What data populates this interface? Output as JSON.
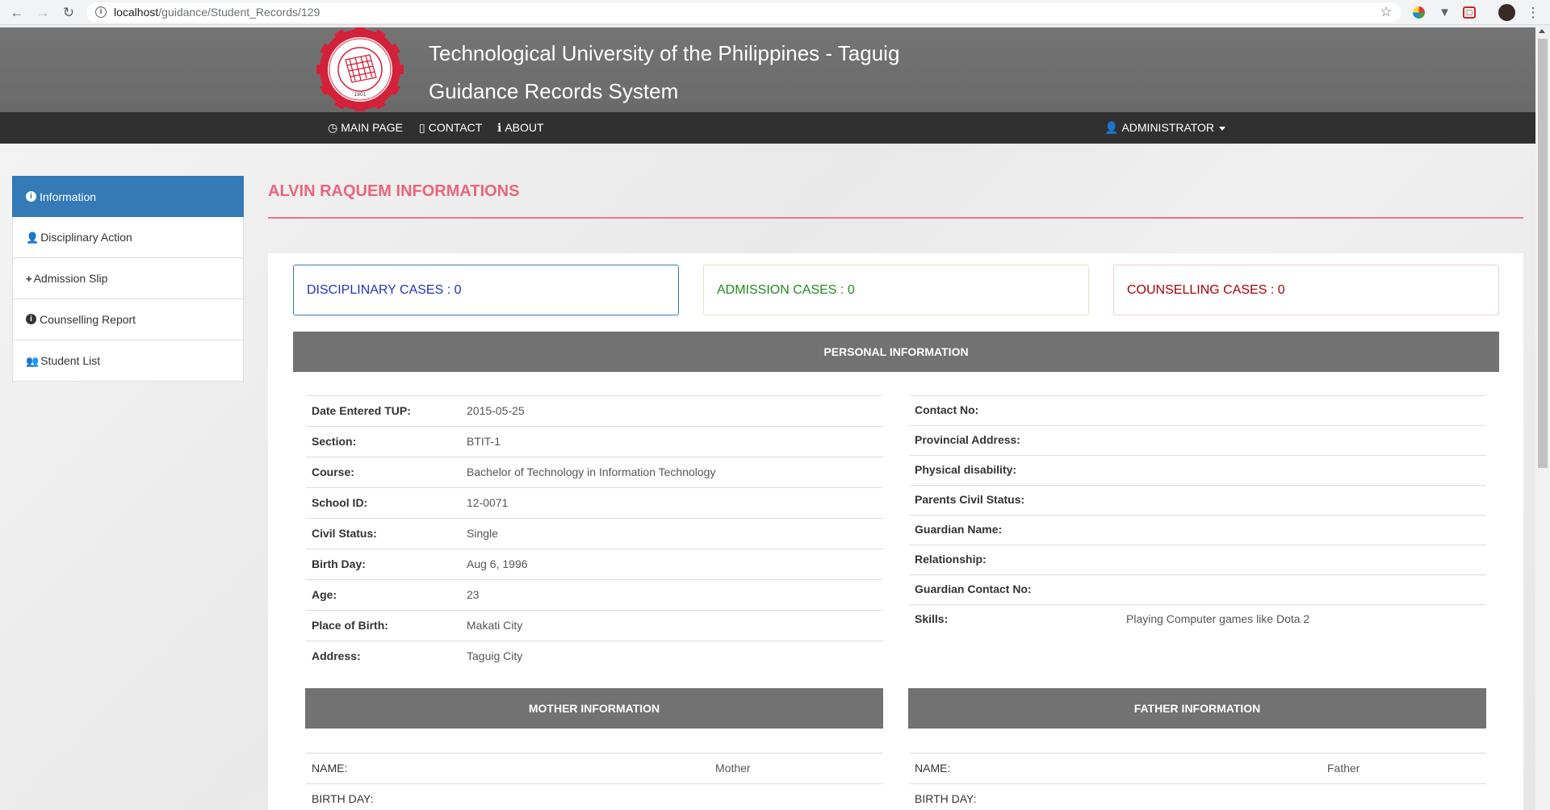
{
  "browser": {
    "url_host": "localhost",
    "url_path": "/guidance/Student_Records/129"
  },
  "header": {
    "title": "Technological University of the Philippines - Taguig",
    "subtitle": "Guidance Records System",
    "logo_text": "TECHNOLOGICAL UNIVERSITY OF THE PHILIPPINES",
    "logo_year": "1901"
  },
  "nav": {
    "main_page": "MAIN PAGE",
    "contact": "CONTACT",
    "about": "ABOUT",
    "user": "ADMINISTRATOR"
  },
  "sidebar": {
    "items": [
      {
        "label": "Information",
        "icon": "info-circle-icon"
      },
      {
        "label": "Disciplinary Action",
        "icon": "user-icon"
      },
      {
        "label": "Admission Slip",
        "icon": "plus-icon"
      },
      {
        "label": "Counselling Report",
        "icon": "info-circle-icon"
      },
      {
        "label": "Student List",
        "icon": "users-icon"
      }
    ]
  },
  "main": {
    "title": "ALVIN RAQUEM INFORMATIONS",
    "cases": {
      "disciplinary": "DISCIPLINARY CASES : 0",
      "admission": "ADMISSION CASES : 0",
      "counselling": "COUNSELLING CASES : 0"
    },
    "personal_header": "PERSONAL INFORMATION",
    "personal_left": [
      {
        "label": "Date Entered TUP:",
        "value": "2015-05-25"
      },
      {
        "label": "Section:",
        "value": "BTIT-1"
      },
      {
        "label": "Course:",
        "value": "Bachelor of Technology in Information Technology"
      },
      {
        "label": "School ID:",
        "value": "12-0071"
      },
      {
        "label": "Civil Status:",
        "value": "Single"
      },
      {
        "label": "Birth Day:",
        "value": "Aug 6, 1996"
      },
      {
        "label": "Age:",
        "value": "23"
      },
      {
        "label": "Place of Birth:",
        "value": "Makati City"
      },
      {
        "label": "Address:",
        "value": "Taguig City"
      }
    ],
    "personal_right": [
      {
        "label": "Contact No:",
        "value": ""
      },
      {
        "label": "Provincial Address:",
        "value": ""
      },
      {
        "label": "Physical disability:",
        "value": ""
      },
      {
        "label": "Parents Civil Status:",
        "value": ""
      },
      {
        "label": "Guardian Name:",
        "value": ""
      },
      {
        "label": "Relationship:",
        "value": ""
      },
      {
        "label": "Guardian Contact No:",
        "value": ""
      },
      {
        "label": "Skills:",
        "value": "Playing Computer games like Dota 2"
      }
    ],
    "mother_header": "MOTHER INFORMATION",
    "father_header": "FATHER INFORMATION",
    "mother_rows": [
      {
        "label": "NAME:",
        "value": "Mother"
      },
      {
        "label": "BIRTH DAY:",
        "value": ""
      }
    ],
    "father_rows": [
      {
        "label": "NAME:",
        "value": "Father"
      },
      {
        "label": "BIRTH DAY:",
        "value": ""
      }
    ]
  },
  "colors": {
    "accent_blue": "#337ab7",
    "title_pink": "#e8667e",
    "header_gray": "#727272",
    "navbar_dark": "#303030"
  }
}
